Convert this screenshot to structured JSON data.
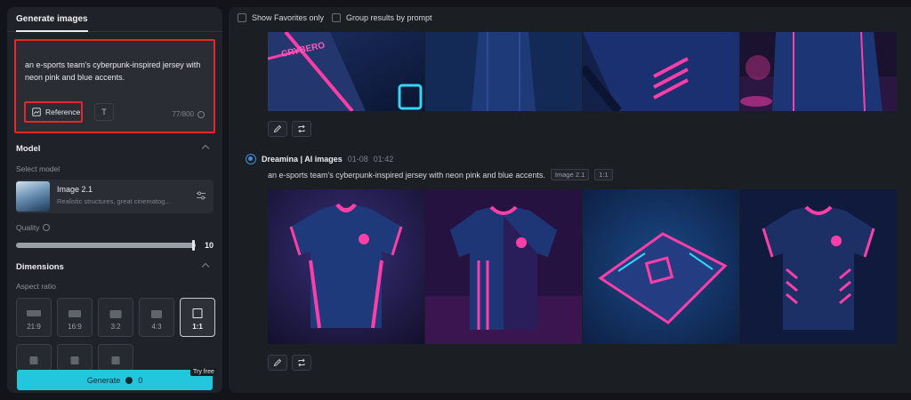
{
  "left_panel": {
    "tab_label": "Generate images",
    "prompt_text": "an e-sports team's cyberpunk-inspired jersey with neon pink and blue accents.",
    "reference_label": "Reference",
    "text_tool_label": "T",
    "char_count": "77/800",
    "model_section_title": "Model",
    "select_model_label": "Select model",
    "model_name": "Image 2.1",
    "model_desc": "Realistic structures, great cinematog...",
    "quality_label": "Quality",
    "quality_value": "10",
    "quality_fraction": 1.0,
    "dimensions_title": "Dimensions",
    "aspect_ratio_label": "Aspect ratio",
    "ratios": [
      "21:9",
      "16:9",
      "3:2",
      "4:3",
      "1:1"
    ],
    "selected_ratio": "1:1",
    "generate_label": "Generate",
    "credit_count": "0",
    "try_free_label": "Try free"
  },
  "main": {
    "favorites_label": "Show Favorites only",
    "group_label": "Group results by prompt",
    "entry": {
      "author": "Dreamina | AI images",
      "date": "01-08",
      "time": "01:42",
      "prompt": "an e-sports team's cyberpunk-inspired jersey with neon pink and blue accents.",
      "model_tag": "Image 2.1",
      "ratio_tag": "1:1"
    },
    "watermark_text": "CRYBERO"
  },
  "colors": {
    "accent_cyan": "#23c6dc",
    "highlight_red": "#e5262b",
    "neon_pink": "#ff3fa8",
    "navy": "#1f3566"
  }
}
